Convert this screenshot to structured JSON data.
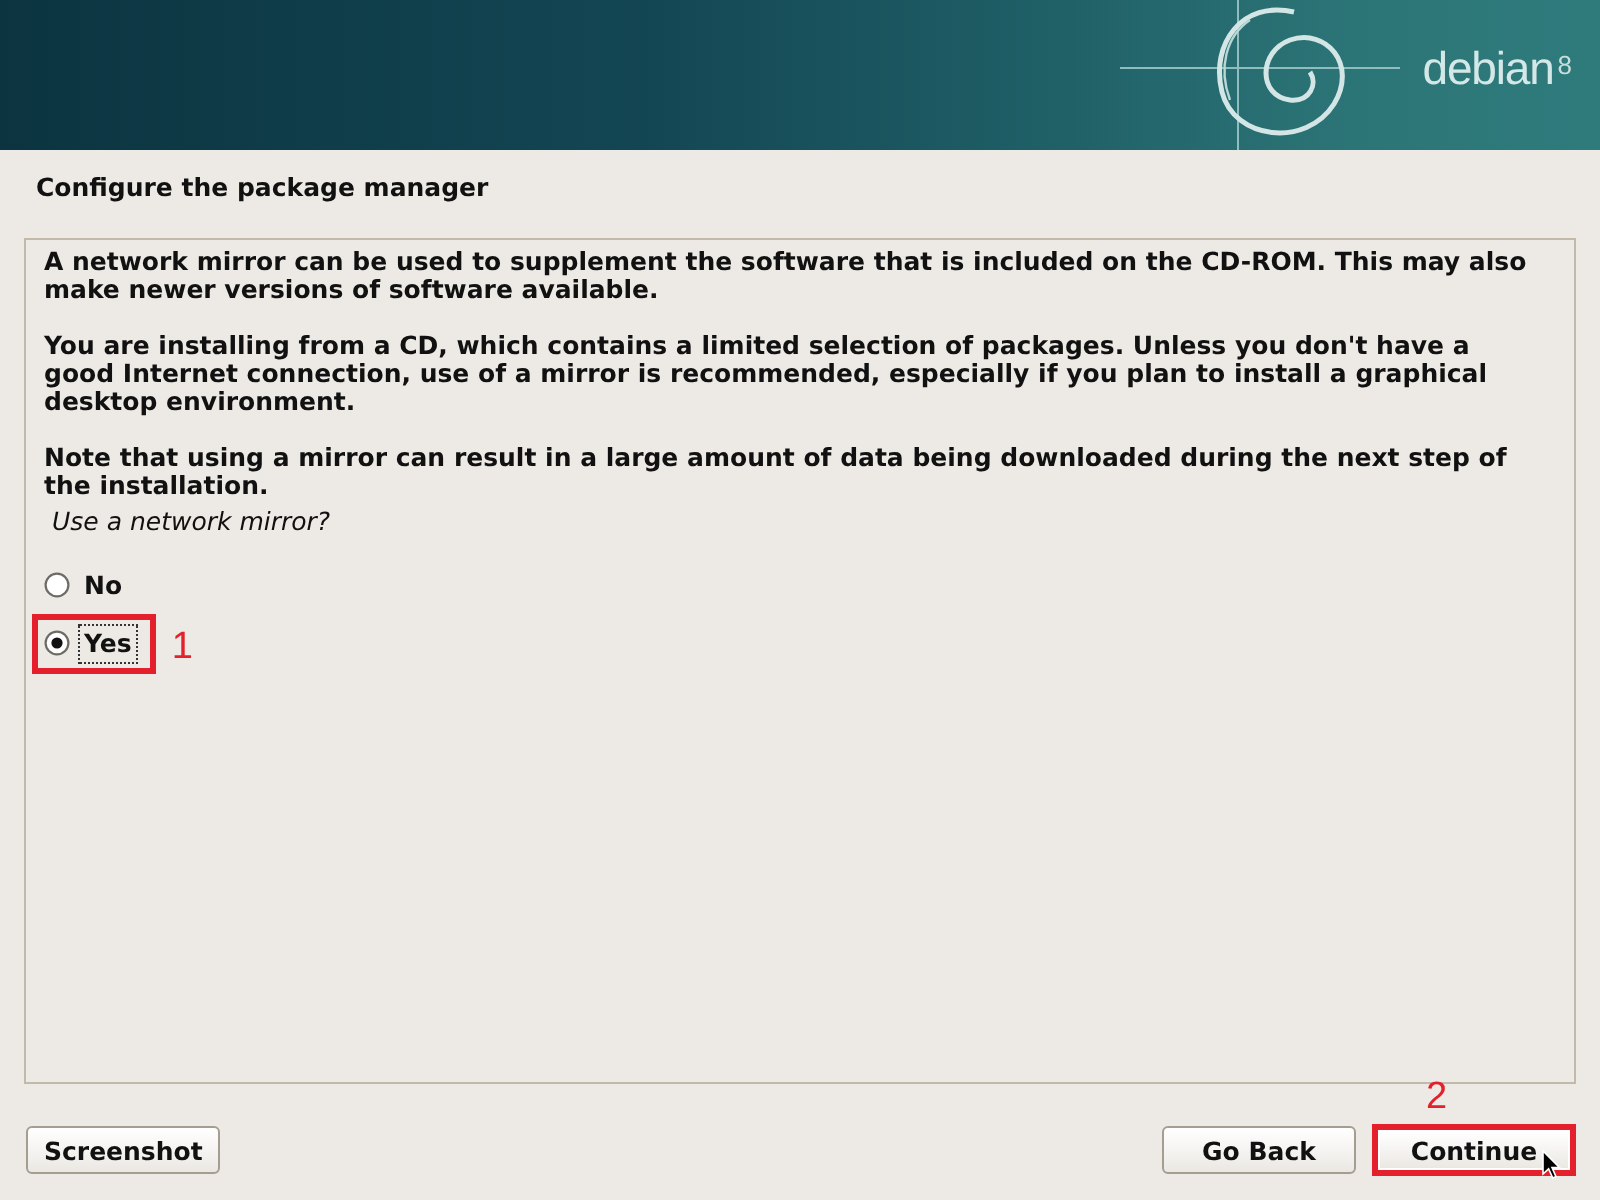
{
  "banner": {
    "logo_text": "debian",
    "version": "8"
  },
  "title": "Configure the package manager",
  "description": [
    "A network mirror can be used to supplement the software that is included on the CD-ROM. This may also make newer versions of software available.",
    "You are installing from a CD, which contains a limited selection of packages. Unless you don't have a good Internet connection, use of a mirror is recommended, especially if you plan to install a graphical desktop environment.",
    "Note that using a mirror can result in a large amount of data being downloaded during the next step of the installation."
  ],
  "question": {
    "prompt": "Use a network mirror?",
    "options": [
      {
        "label": "No",
        "selected": false,
        "focused": false
      },
      {
        "label": "Yes",
        "selected": true,
        "focused": true,
        "callout": "1"
      }
    ]
  },
  "footer": {
    "left": [
      {
        "label": "Screenshot"
      }
    ],
    "right": [
      {
        "label": "Go Back"
      },
      {
        "label": "Continue",
        "callout": "2"
      }
    ]
  }
}
